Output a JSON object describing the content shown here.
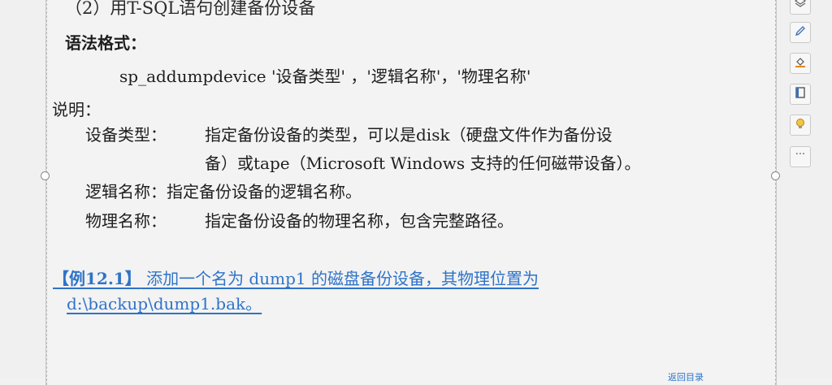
{
  "slide": {
    "heading": "（2）用T-SQL语句创建备份设备",
    "syntax_label": "语法格式：",
    "command": "sp_addumpdevice '设备类型' ，'逻辑名称'，'物理名称'",
    "explain_label": "说明：",
    "items": [
      {
        "label": "设备类型：",
        "desc_line1": "指定备份设备的类型，可以是disk（硬盘文件作为备份设",
        "desc_line2": "备）或tape（Microsoft Windows 支持的任何磁带设备）。"
      },
      {
        "full": "逻辑名称：指定备份设备的逻辑名称。"
      },
      {
        "label": "物理名称：",
        "desc_line1": "指定备份设备的物理名称，包含完整路径。"
      }
    ],
    "example": {
      "label": "【例12.1】",
      "line1": " 添加一个名为 dump1 的磁盘备份设备，其物理位置为",
      "line2": "d:\\backup\\dump1.bak。"
    },
    "back_link": "返回目录"
  },
  "toolbar": {
    "buttons": [
      "layers-icon",
      "pen-icon",
      "fill-icon",
      "border-icon",
      "lightbulb-icon",
      "more-icon"
    ],
    "more_label": "···"
  },
  "colors": {
    "link": "#2f73c8",
    "text": "#1e1e1e",
    "background": "#f3f3f3"
  }
}
